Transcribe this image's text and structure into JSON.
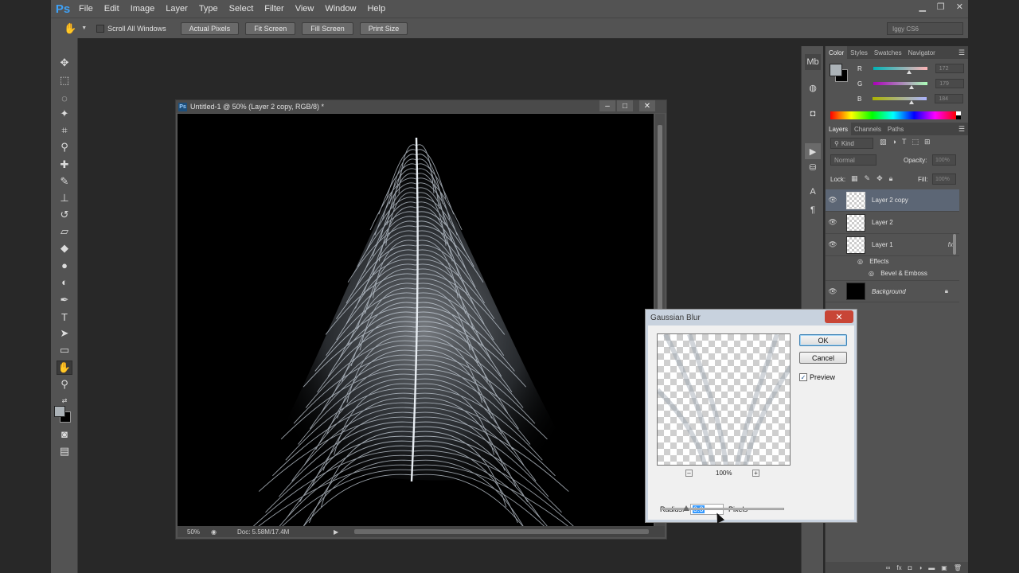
{
  "app": {
    "logo": "Ps"
  },
  "menu": [
    "File",
    "Edit",
    "Image",
    "Layer",
    "Type",
    "Select",
    "Filter",
    "View",
    "Window",
    "Help"
  ],
  "options_bar": {
    "scroll_all_label": "Scroll All Windows",
    "buttons": [
      "Actual Pixels",
      "Fit Screen",
      "Fill Screen",
      "Print Size"
    ],
    "workspace": "Iggy CS6"
  },
  "document": {
    "title": "Untitled-1 @ 50% (Layer 2 copy, RGB/8) *",
    "zoom": "50%",
    "doc_info": "Doc: 5.58M/17.4M"
  },
  "color_panel": {
    "tabs": [
      "Color",
      "Styles",
      "Swatches",
      "Navigator"
    ],
    "channels": [
      {
        "label": "R",
        "value": "172",
        "level": 0.67,
        "gradient": "linear-gradient(90deg,#00b3b6,#ffb3b6)"
      },
      {
        "label": "G",
        "value": "179",
        "level": 0.7,
        "gradient": "linear-gradient(90deg,#ab00b8,#abffb8)"
      },
      {
        "label": "B",
        "value": "184",
        "level": 0.72,
        "gradient": "linear-gradient(90deg,#abb300,#abb3ff)"
      }
    ],
    "foreground": "#acb3b8",
    "background": "#000000"
  },
  "layers_panel": {
    "tabs": [
      "Layers",
      "Channels",
      "Paths"
    ],
    "filter_kind": "Kind",
    "blend_mode": "Normal",
    "opacity_label": "Opacity:",
    "opacity": "100%",
    "lock_label": "Lock:",
    "fill_label": "Fill:",
    "fill": "100%",
    "layers": [
      {
        "name": "Layer 2 copy",
        "selected": true
      },
      {
        "name": "Layer 2",
        "selected": false
      },
      {
        "name": "Layer 1",
        "selected": false,
        "fx": "fx"
      }
    ],
    "effects_label": "Effects",
    "effect_item": "Bevel & Emboss",
    "background_layer": "Background"
  },
  "dialog": {
    "title": "Gaussian Blur",
    "ok_label": "OK",
    "cancel_label": "Cancel",
    "preview_label": "Preview",
    "preview_checked": true,
    "zoom_label": "100%",
    "radius_label": "Radius:",
    "radius_value": "3.8",
    "radius_unit": "Pixels",
    "close_label": "✕"
  }
}
